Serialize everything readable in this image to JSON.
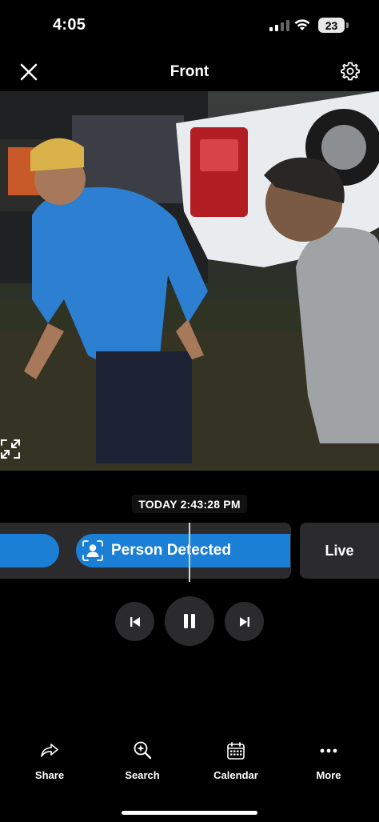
{
  "status_bar": {
    "time": "4:05",
    "battery": "23"
  },
  "header": {
    "title": "Front"
  },
  "video": {
    "timestamp": "TODAY 2:43:28 PM"
  },
  "timeline": {
    "event_label": "Person Detected",
    "live_label": "Live",
    "event_color": "#1c7fd6"
  },
  "controls": {
    "prev_icon": "skip-previous-icon",
    "pause_icon": "pause-icon",
    "next_icon": "skip-next-icon"
  },
  "nav": {
    "items": [
      {
        "label": "Share",
        "icon": "share-icon"
      },
      {
        "label": "Search",
        "icon": "search-icon"
      },
      {
        "label": "Calendar",
        "icon": "calendar-icon"
      },
      {
        "label": "More",
        "icon": "more-icon"
      }
    ]
  }
}
